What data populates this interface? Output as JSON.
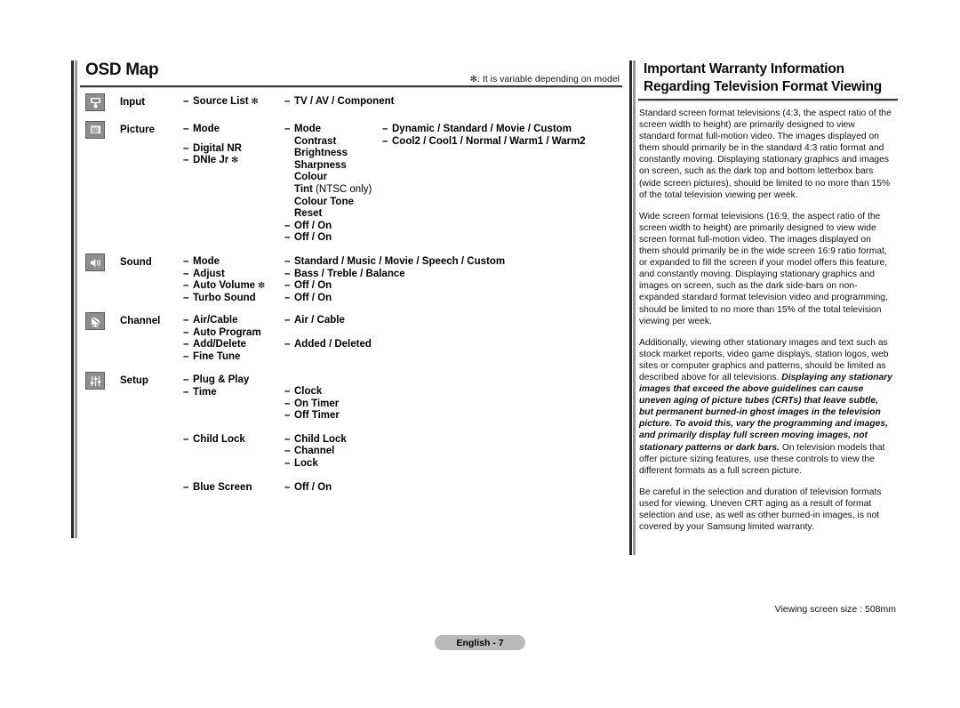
{
  "left": {
    "title": "OSD Map",
    "note_symbol": "✻",
    "note": ": It is variable depending on model",
    "groups": [
      {
        "icon": "input-jack-icon",
        "label": "Input",
        "col2": [
          {
            "dash": true,
            "text": "Source List",
            "star": true
          }
        ],
        "col3": [
          {
            "dash": true,
            "text": "TV / AV / Component"
          }
        ],
        "col4": []
      },
      {
        "icon": "picture-screen-icon",
        "label": "Picture",
        "col2": [
          {
            "dash": true,
            "text": "Mode"
          },
          {
            "dash": true,
            "text": "Digital NR",
            "offset": 8
          },
          {
            "dash": true,
            "text": "DNIe Jr",
            "star": true
          }
        ],
        "col3": [
          {
            "dash": true,
            "text": "Mode"
          },
          {
            "dash": false,
            "text": "Contrast"
          },
          {
            "dash": false,
            "text": "Brightness"
          },
          {
            "dash": false,
            "text": "Sharpness"
          },
          {
            "dash": false,
            "text": "Colour"
          },
          {
            "dash": false,
            "text": "Tint",
            "suffix": " (NTSC only)"
          },
          {
            "dash": false,
            "text": "Colour Tone"
          },
          {
            "dash": false,
            "text": "Reset"
          },
          {
            "dash": true,
            "text": "Off / On"
          },
          {
            "dash": true,
            "text": "Off / On"
          }
        ],
        "col4": [
          {
            "dash": true,
            "text": "Dynamic / Standard / Movie / Custom"
          },
          {
            "dash": true,
            "text": "Cool2 / Cool1 / Normal / Warm1 / Warm2"
          }
        ]
      },
      {
        "icon": "speaker-icon",
        "label": "Sound",
        "col2": [
          {
            "dash": true,
            "text": "Mode"
          },
          {
            "dash": true,
            "text": "Adjust"
          },
          {
            "dash": true,
            "text": "Auto Volume",
            "star": true
          },
          {
            "dash": true,
            "text": "Turbo Sound"
          }
        ],
        "col3": [
          {
            "dash": true,
            "text": "Standard / Music / Movie / Speech / Custom"
          },
          {
            "dash": true,
            "text": "Bass / Treble / Balance"
          },
          {
            "dash": true,
            "text": "Off / On"
          },
          {
            "dash": true,
            "text": "Off / On"
          }
        ],
        "col4": []
      },
      {
        "icon": "satellite-dish-icon",
        "label": "Channel",
        "col2": [
          {
            "dash": true,
            "text": "Air/Cable"
          },
          {
            "dash": true,
            "text": "Auto Program"
          },
          {
            "dash": true,
            "text": "Add/Delete"
          },
          {
            "dash": true,
            "text": "Fine Tune"
          }
        ],
        "col3": [
          {
            "dash": true,
            "text": "Air / Cable"
          },
          {
            "dash": false,
            "text": ""
          },
          {
            "dash": true,
            "text": "Added / Deleted"
          }
        ],
        "col4": []
      },
      {
        "icon": "sliders-icon",
        "label": "Setup",
        "col2": [
          {
            "dash": true,
            "text": "Plug & Play"
          },
          {
            "dash": true,
            "text": "Time"
          },
          {
            "dash": true,
            "text": "Child Lock",
            "offset": 40
          },
          {
            "dash": true,
            "text": "Blue Screen",
            "offset": 40
          }
        ],
        "col3": [
          {
            "dash": true,
            "text": "Clock",
            "offset": 13
          },
          {
            "dash": true,
            "text": "On Timer"
          },
          {
            "dash": true,
            "text": "Off Timer"
          },
          {
            "dash": true,
            "text": "Child Lock",
            "offset": 13
          },
          {
            "dash": true,
            "text": "Channel"
          },
          {
            "dash": true,
            "text": "Lock"
          },
          {
            "dash": true,
            "text": "Off / On",
            "offset": 13
          }
        ],
        "col4": []
      }
    ]
  },
  "right": {
    "title_line1": "Important Warranty Information",
    "title_line2": "Regarding Television Format Viewing",
    "paragraphs": [
      {
        "runs": [
          {
            "text": "Standard screen format televisions (4:3, the aspect ratio of the screen width to height) are primarily designed to view standard format full-motion video. The images displayed on them should primarily be in the standard 4:3 ratio format and constantly moving. Displaying stationary graphics and images on screen, such as the dark top and bottom letterbox bars (wide screen pictures), should be limited to no more than 15% of the total television viewing per week."
          }
        ]
      },
      {
        "runs": [
          {
            "text": "Wide screen format televisions (16:9, the aspect ratio of the screen width to height) are primarily designed to view wide screen format full-motion video. The images displayed on them should primarily be in the wide screen 16:9 ratio format, or expanded to fill the screen if your model offers this feature, and constantly moving. Displaying stationary graphics and images on screen, such as the dark side-bars on non-expanded standard format television video and programming, should be limited to no more than 15% of the total television viewing per week."
          }
        ]
      },
      {
        "runs": [
          {
            "text": "Additionally, viewing other stationary images and text such as stock market reports, video game displays, station logos, web sites or computer graphics and patterns, should be limited as described above for all televisions. "
          },
          {
            "text": "Displaying any stationary images that exceed the above guidelines can cause uneven aging of picture tubes (CRTs) that leave subtle, but permanent burned-in ghost images in the television picture. To avoid this, vary the programming and images, and primarily display full screen moving images, not stationary patterns or dark bars.",
            "emphasis": true
          },
          {
            "text": " On television models that offer picture sizing features, use these controls to view the different formats as a full screen picture."
          }
        ]
      },
      {
        "runs": [
          {
            "text": "Be careful in the selection and duration of television formats used for viewing. Uneven CRT aging as a result of format selection and use, as well as other burned-in images, is not covered by your Samsung limited warranty."
          }
        ]
      }
    ]
  },
  "footer": {
    "viewing_size": "Viewing screen size : 508mm",
    "page_label": "English - 7"
  }
}
